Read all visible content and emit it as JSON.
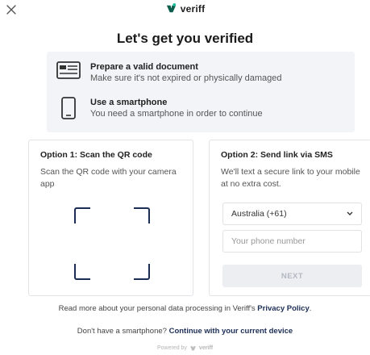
{
  "header": {
    "close_icon": "close-icon",
    "brand_name": "veriff",
    "brand_color": "#0b5d4b"
  },
  "title": "Let's get you verified",
  "requirements": [
    {
      "icon": "id-card-icon",
      "title": "Prepare a valid document",
      "description": "Make sure it's not expired or physically damaged"
    },
    {
      "icon": "smartphone-icon",
      "title": "Use a smartphone",
      "description": "You need a smartphone in order to continue"
    }
  ],
  "option_qr": {
    "title": "Option 1: Scan the QR code",
    "description": "Scan the QR code with your camera app"
  },
  "option_sms": {
    "title": "Option 2: Send link via SMS",
    "description": "We'll text a secure link to your mobile at no extra cost.",
    "country_selected": "Australia (+61)",
    "phone_placeholder": "Your phone number",
    "next_label": "NEXT"
  },
  "footer": {
    "privacy_text": "Read more about your personal data processing in Veriff's ",
    "privacy_link": "Privacy Policy",
    "privacy_end": ".",
    "device_text": "Don't have a smartphone? ",
    "device_link": "Continue with your current device",
    "powered_by": "Powered by",
    "powered_brand": "veriff"
  },
  "colors": {
    "accent": "#1c2e55",
    "panel": "#f3f4f8",
    "button_disabled": "#eceef2"
  }
}
